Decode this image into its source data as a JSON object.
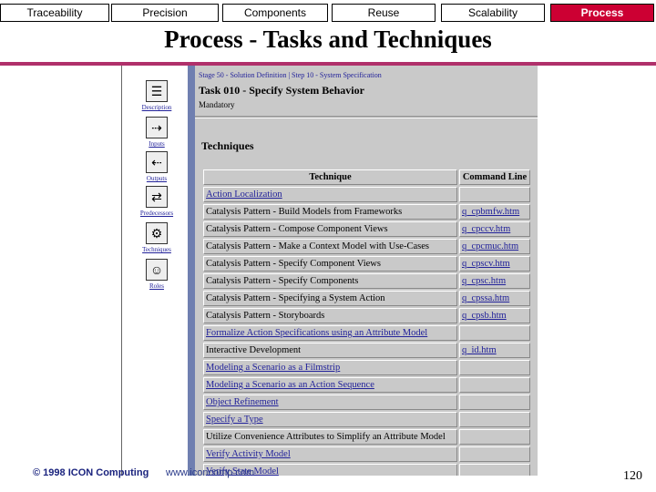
{
  "nav": {
    "tabs": [
      {
        "label": "Traceability"
      },
      {
        "label": "Precision"
      },
      {
        "label": "Components"
      },
      {
        "label": "Reuse"
      },
      {
        "label": "Scalability"
      },
      {
        "label": "Process"
      }
    ],
    "active_color": "#cc0033"
  },
  "slide": {
    "title": "Process - Tasks and Techniques",
    "rule_color": "#b0306a",
    "footer_copyright": "© 1998 ICON Computing",
    "footer_url": "www.iconcomp.com",
    "page_number": "120"
  },
  "screenshot": {
    "sidebar": [
      {
        "label": "Description",
        "icon": "document-icon",
        "glyph": "☰"
      },
      {
        "label": "Inputs",
        "icon": "inputs-icon",
        "glyph": "⇢"
      },
      {
        "label": "Outputs",
        "icon": "outputs-icon",
        "glyph": "⇠"
      },
      {
        "label": "Predecessors",
        "icon": "predecessors-icon",
        "glyph": "⇄"
      },
      {
        "label": "Techniques",
        "icon": "techniques-icon",
        "glyph": "⚙"
      },
      {
        "label": "Roles",
        "icon": "roles-icon",
        "glyph": "☺"
      }
    ],
    "breadcrumb": "Stage 50 - Solution Definition | Step 10 - System Specification",
    "task_title": "Task 010 - Specify System Behavior",
    "mandatory": "Mandatory",
    "techniques_heading": "Techniques",
    "table": {
      "headers": [
        "Technique",
        "Command Line"
      ],
      "rows": [
        {
          "technique": "Action Localization",
          "command": "",
          "link": true
        },
        {
          "technique": "Catalysis Pattern - Build Models from Frameworks",
          "command": "q_cpbmfw.htm",
          "link": false
        },
        {
          "technique": "Catalysis Pattern - Compose Component Views",
          "command": "q_cpccv.htm",
          "link": false
        },
        {
          "technique": "Catalysis Pattern - Make a Context Model with Use-Cases",
          "command": "q_cpcmuc.htm",
          "link": false
        },
        {
          "technique": "Catalysis Pattern - Specify Component Views",
          "command": "q_cpscv.htm",
          "link": false
        },
        {
          "technique": "Catalysis Pattern - Specify Components",
          "command": "q_cpsc.htm",
          "link": false
        },
        {
          "technique": "Catalysis Pattern - Specifying a System Action",
          "command": "q_cpssa.htm",
          "link": false
        },
        {
          "technique": "Catalysis Pattern - Storyboards",
          "command": "q_cpsb.htm",
          "link": false
        },
        {
          "technique": "Formalize Action Specifications using an Attribute Model",
          "command": "",
          "link": true
        },
        {
          "technique": "Interactive Development",
          "command": "q_id.htm",
          "link": false
        },
        {
          "technique": "Modeling a Scenario as a Filmstrip",
          "command": "",
          "link": true
        },
        {
          "technique": "Modeling a Scenario as an Action Sequence",
          "command": "",
          "link": true
        },
        {
          "technique": "Object Refinement",
          "command": "",
          "link": true
        },
        {
          "technique": "Specify a Type",
          "command": "",
          "link": true
        },
        {
          "technique": "Utilize Convenience Attributes to Simplify an Attribute Model",
          "command": "",
          "link": false
        },
        {
          "technique": "Verify Activity Model",
          "command": "",
          "link": true
        },
        {
          "technique": "Verify State Model",
          "command": "",
          "link": true
        }
      ]
    }
  }
}
